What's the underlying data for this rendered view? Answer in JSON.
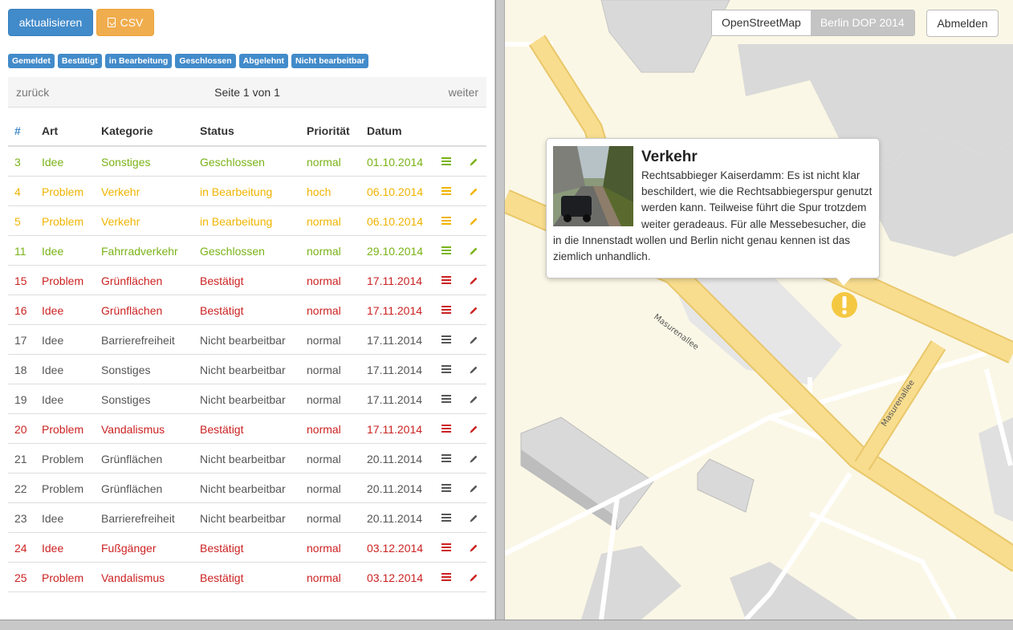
{
  "toolbar": {
    "refresh_label": "aktualisieren",
    "csv_label": "CSV"
  },
  "filters": [
    "Gemeldet",
    "Bestätigt",
    "in Bearbeitung",
    "Geschlossen",
    "Abgelehnt",
    "Nicht bearbeitbar"
  ],
  "pager": {
    "prev": "zurück",
    "info": "Seite 1 von 1",
    "next": "weiter"
  },
  "table": {
    "headers": [
      "#",
      "Art",
      "Kategorie",
      "Status",
      "Priorität",
      "Datum"
    ],
    "rows": [
      {
        "id": "3",
        "art": "Idee",
        "kategorie": "Sonstiges",
        "status": "Geschlossen",
        "prio": "normal",
        "datum": "01.10.2014",
        "color": "green"
      },
      {
        "id": "4",
        "art": "Problem",
        "kategorie": "Verkehr",
        "status": "in Bearbeitung",
        "prio": "hoch",
        "datum": "06.10.2014",
        "color": "orange"
      },
      {
        "id": "5",
        "art": "Problem",
        "kategorie": "Verkehr",
        "status": "in Bearbeitung",
        "prio": "normal",
        "datum": "06.10.2014",
        "color": "orange"
      },
      {
        "id": "11",
        "art": "Idee",
        "kategorie": "Fahrradverkehr",
        "status": "Geschlossen",
        "prio": "normal",
        "datum": "29.10.2014",
        "color": "green"
      },
      {
        "id": "15",
        "art": "Problem",
        "kategorie": "Grünflächen",
        "status": "Bestätigt",
        "prio": "normal",
        "datum": "17.11.2014",
        "color": "red"
      },
      {
        "id": "16",
        "art": "Idee",
        "kategorie": "Grünflächen",
        "status": "Bestätigt",
        "prio": "normal",
        "datum": "17.11.2014",
        "color": "red"
      },
      {
        "id": "17",
        "art": "Idee",
        "kategorie": "Barrierefreiheit",
        "status": "Nicht bearbeitbar",
        "prio": "normal",
        "datum": "17.11.2014",
        "color": "gray"
      },
      {
        "id": "18",
        "art": "Idee",
        "kategorie": "Sonstiges",
        "status": "Nicht bearbeitbar",
        "prio": "normal",
        "datum": "17.11.2014",
        "color": "gray"
      },
      {
        "id": "19",
        "art": "Idee",
        "kategorie": "Sonstiges",
        "status": "Nicht bearbeitbar",
        "prio": "normal",
        "datum": "17.11.2014",
        "color": "gray"
      },
      {
        "id": "20",
        "art": "Problem",
        "kategorie": "Vandalismus",
        "status": "Bestätigt",
        "prio": "normal",
        "datum": "17.11.2014",
        "color": "red"
      },
      {
        "id": "21",
        "art": "Problem",
        "kategorie": "Grünflächen",
        "status": "Nicht bearbeitbar",
        "prio": "normal",
        "datum": "20.11.2014",
        "color": "gray"
      },
      {
        "id": "22",
        "art": "Problem",
        "kategorie": "Grünflächen",
        "status": "Nicht bearbeitbar",
        "prio": "normal",
        "datum": "20.11.2014",
        "color": "gray"
      },
      {
        "id": "23",
        "art": "Idee",
        "kategorie": "Barrierefreiheit",
        "status": "Nicht bearbeitbar",
        "prio": "normal",
        "datum": "20.11.2014",
        "color": "gray"
      },
      {
        "id": "24",
        "art": "Idee",
        "kategorie": "Fußgänger",
        "status": "Bestätigt",
        "prio": "normal",
        "datum": "03.12.2014",
        "color": "red"
      },
      {
        "id": "25",
        "art": "Problem",
        "kategorie": "Vandalismus",
        "status": "Bestätigt",
        "prio": "normal",
        "datum": "03.12.2014",
        "color": "red"
      }
    ]
  },
  "map": {
    "layers": [
      "OpenStreetMap",
      "Berlin DOP 2014"
    ],
    "active_layer": "Berlin DOP 2014",
    "logout_label": "Abmelden",
    "street_labels": [
      "Masurenallee",
      "Masurenallee"
    ],
    "popup": {
      "title": "Verkehr",
      "text": "Rechtsabbieger Kaiserdamm: Es ist nicht klar beschildert, wie die Rechtsabbiegerspur genutzt werden kann. Teilweise führt die Spur trotzdem weiter geradeaus. Für alle Messebesucher, die in die Innenstadt wollen und Berlin nicht genau kennen ist das ziemlich unhandlich."
    },
    "marker_icon": "exclamation-icon"
  },
  "icons": {
    "list": "list-icon",
    "edit": "pencil-icon",
    "file": "file-icon"
  },
  "colors": {
    "green": "#7ab317",
    "orange": "#f0b400",
    "red": "#cc2222",
    "gray": "#555555",
    "primary": "#428bca",
    "warning": "#f0ad4e",
    "marker": "#f5c842"
  }
}
